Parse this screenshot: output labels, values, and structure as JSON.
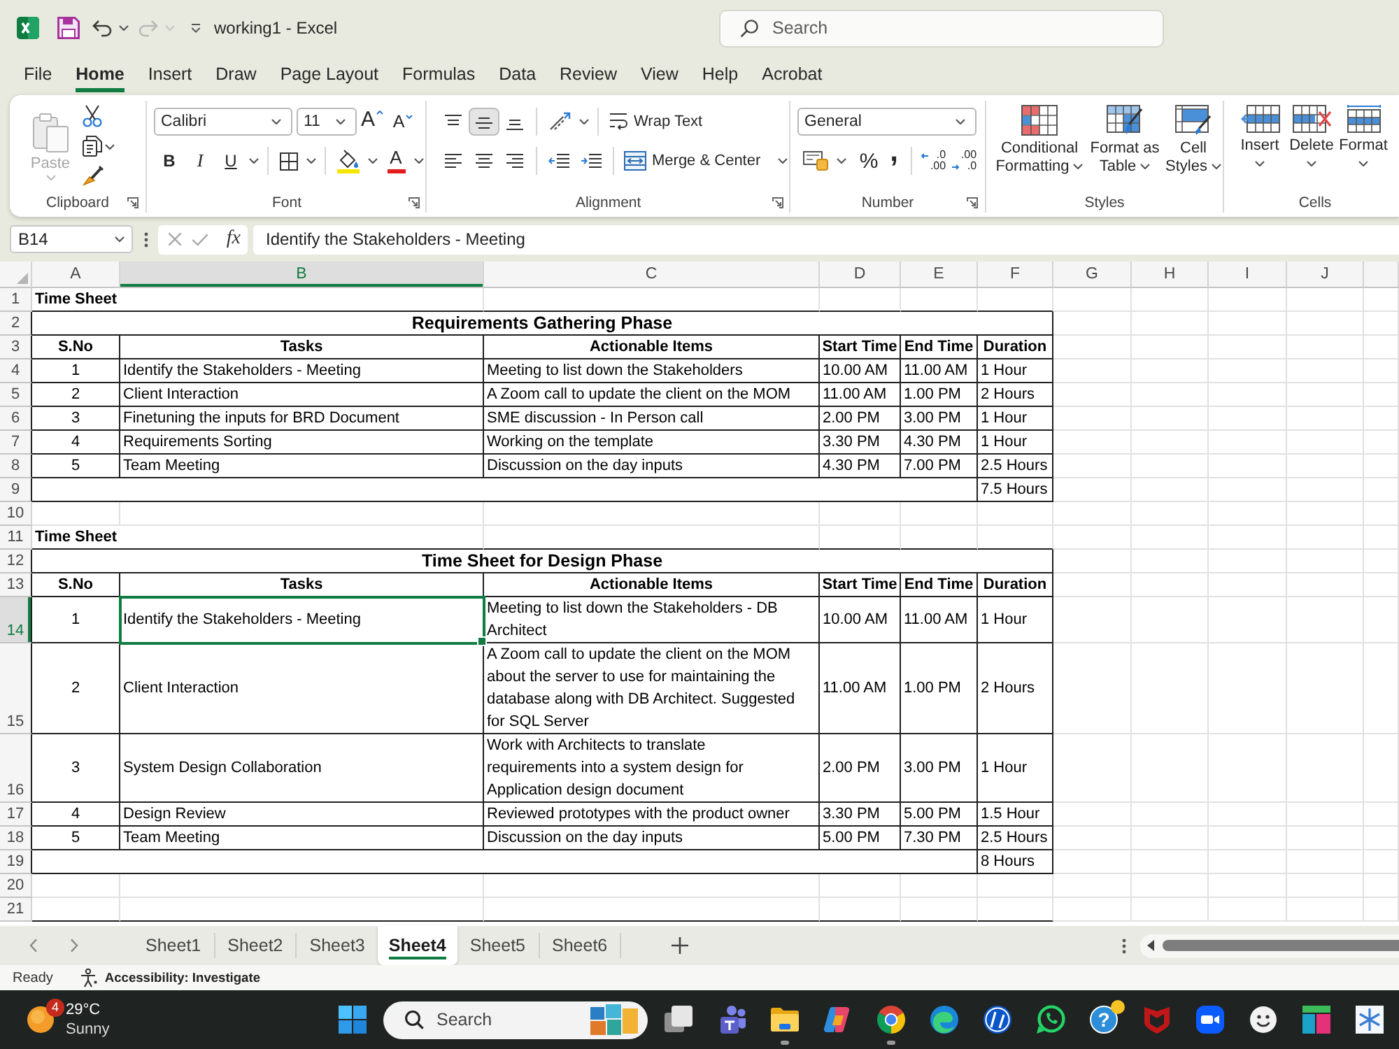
{
  "title_bar": {
    "title": "working1 - Excel",
    "redo": {
      "disabled": true
    },
    "search": {
      "placeholder": "Search"
    }
  },
  "menu_tabs": [
    {
      "label": "File",
      "selected": false
    },
    {
      "label": "Home",
      "selected": true
    },
    {
      "label": "Insert",
      "selected": false
    },
    {
      "label": "Draw",
      "selected": false
    },
    {
      "label": "Page Layout",
      "selected": false
    },
    {
      "label": "Formulas",
      "selected": false
    },
    {
      "label": "Data",
      "selected": false
    },
    {
      "label": "Review",
      "selected": false
    },
    {
      "label": "View",
      "selected": false
    },
    {
      "label": "Help",
      "selected": false
    },
    {
      "label": "Acrobat",
      "selected": false
    }
  ],
  "ribbon": {
    "clipboard": {
      "label": "Clipboard",
      "paste": {
        "label": "Paste",
        "disabled": true
      }
    },
    "font": {
      "label": "Font",
      "font_name": "Calibri",
      "font_size": "11",
      "grow_font": "A",
      "shrink_font": "A",
      "bold": "B",
      "italic": "I",
      "underline": "U",
      "font_color": "A"
    },
    "alignment": {
      "label": "Alignment",
      "vertical": [
        {
          "kind": "top",
          "selected": false
        },
        {
          "kind": "middle",
          "selected": true
        },
        {
          "kind": "bottom",
          "selected": false
        }
      ],
      "wrap_text": "Wrap Text",
      "merge": "Merge & Center"
    },
    "number": {
      "label": "Number",
      "format": "General",
      "percent": "%",
      "comma": ",",
      "increase_decimal": [
        ".0",
        ".00"
      ],
      "decrease_decimal": [
        ".00",
        ".0"
      ]
    },
    "styles": {
      "label": "Styles",
      "buttons": [
        {
          "kind": "conditional",
          "label": "Conditional Formatting"
        },
        {
          "kind": "table",
          "label": "Format as Table"
        },
        {
          "kind": "cell",
          "label": "Cell Styles"
        }
      ]
    },
    "cells": {
      "label": "Cells",
      "buttons": [
        {
          "kind": "insert",
          "label": "Insert"
        },
        {
          "kind": "delete",
          "label": "Delete"
        },
        {
          "kind": "format",
          "label": "Format"
        }
      ]
    }
  },
  "formula_bar": {
    "name_box": "B14",
    "function_label": "fx",
    "formula": "Identify the Stakeholders - Meeting"
  },
  "sheet": {
    "columns": [
      {
        "label": "A",
        "selected": false
      },
      {
        "label": "B",
        "selected": true
      },
      {
        "label": "C",
        "selected": false
      },
      {
        "label": "D",
        "selected": false
      },
      {
        "label": "E",
        "selected": false
      },
      {
        "label": "F",
        "selected": false
      },
      {
        "label": "G",
        "selected": false
      },
      {
        "label": "H",
        "selected": false
      },
      {
        "label": "I",
        "selected": false
      },
      {
        "label": "J",
        "selected": false
      }
    ],
    "rows": [
      {
        "number": "1",
        "selected": false,
        "kind": "title",
        "text": "Time Sheet"
      },
      {
        "number": "2",
        "selected": false,
        "kind": "banner",
        "text": "Requirements Gathering Phase"
      },
      {
        "number": "3",
        "selected": false,
        "kind": "header",
        "cells": [
          "S.No",
          "Tasks",
          "Actionable Items",
          "Start Time",
          "End Time",
          "Duration"
        ]
      },
      {
        "number": "4",
        "selected": false,
        "kind": "record",
        "cells": [
          "1",
          "Identify the Stakeholders - Meeting",
          "Meeting to list down the Stakeholders",
          "10.00 AM",
          "11.00 AM",
          "1 Hour"
        ]
      },
      {
        "number": "5",
        "selected": false,
        "kind": "record",
        "cells": [
          "2",
          "Client Interaction",
          "A Zoom call to update the client on the MOM",
          "11.00 AM",
          "1.00 PM",
          "2 Hours"
        ]
      },
      {
        "number": "6",
        "selected": false,
        "kind": "record",
        "cells": [
          "3",
          "Finetuning the inputs for BRD Document",
          "SME discussion - In Person call",
          "2.00 PM",
          "3.00 PM",
          "1 Hour"
        ]
      },
      {
        "number": "7",
        "selected": false,
        "kind": "record",
        "cells": [
          "4",
          "Requirements Sorting",
          "Working on the template",
          "3.30 PM",
          "4.30 PM",
          "1 Hour"
        ]
      },
      {
        "number": "8",
        "selected": false,
        "kind": "record",
        "cells": [
          "5",
          "Team Meeting",
          "Discussion on the day inputs",
          "4.30 PM",
          "7.00 PM",
          "2.5 Hours"
        ]
      },
      {
        "number": "9",
        "selected": false,
        "kind": "total",
        "text": "7.5 Hours"
      },
      {
        "number": "10",
        "selected": false,
        "kind": "blank"
      },
      {
        "number": "11",
        "selected": false,
        "kind": "title",
        "text": "Time Sheet"
      },
      {
        "number": "12",
        "selected": false,
        "kind": "banner",
        "text": "Time Sheet for Design Phase"
      },
      {
        "number": "13",
        "selected": false,
        "kind": "header",
        "cells": [
          "S.No",
          "Tasks",
          "Actionable Items",
          "Start Time",
          "End Time",
          "Duration"
        ]
      },
      {
        "number": "14",
        "selected": true,
        "kind": "record",
        "cells": [
          "1",
          "Identify the Stakeholders - Meeting",
          "Meeting to list down the Stakeholders - DB\nArchitect",
          "10.00 AM",
          "11.00 AM",
          "1 Hour"
        ]
      },
      {
        "number": "15",
        "selected": false,
        "kind": "record",
        "cells": [
          "2",
          "Client Interaction",
          "A Zoom call to update the client on the MOM\nabout the server to use for maintaining the\ndatabase along with DB Architect. Suggested\nfor SQL Server",
          "11.00 AM",
          "1.00 PM",
          "2 Hours"
        ]
      },
      {
        "number": "16",
        "selected": false,
        "kind": "record",
        "cells": [
          "3",
          "System Design Collaboration",
          "Work with Architects to translate\nrequirements into a system design for\nApplication design document",
          "2.00 PM",
          "3.00 PM",
          "1 Hour"
        ]
      },
      {
        "number": "17",
        "selected": false,
        "kind": "record",
        "cells": [
          "4",
          "Design Review",
          "Reviewed prototypes with the product owner",
          "3.30 PM",
          "5.00 PM",
          "1.5 Hour"
        ]
      },
      {
        "number": "18",
        "selected": false,
        "kind": "record",
        "cells": [
          "5",
          "Team Meeting",
          "Discussion on the day inputs",
          "5.00 PM",
          "7.30 PM",
          "2.5 Hours"
        ]
      },
      {
        "number": "19",
        "selected": false,
        "kind": "total",
        "text": "8 Hours"
      },
      {
        "number": "20",
        "selected": false,
        "kind": "blank"
      },
      {
        "number": "21",
        "selected": false,
        "kind": "blank"
      }
    ]
  },
  "sheet_tabs": [
    {
      "label": "Sheet1",
      "selected": false
    },
    {
      "label": "Sheet2",
      "selected": false
    },
    {
      "label": "Sheet3",
      "selected": false
    },
    {
      "label": "Sheet4",
      "selected": true
    },
    {
      "label": "Sheet5",
      "selected": false
    },
    {
      "label": "Sheet6",
      "selected": false
    }
  ],
  "status_bar": {
    "mode": "Ready",
    "accessibility": "Accessibility: Investigate"
  },
  "taskbar": {
    "weather": {
      "badge": "4",
      "temperature": "29°C",
      "condition": "Sunny"
    },
    "search": {
      "placeholder": "Search"
    },
    "apps": [
      {
        "kind": "task-view",
        "running": false,
        "alert": false
      },
      {
        "kind": "teams",
        "running": false,
        "alert": false
      },
      {
        "kind": "explorer",
        "running": true,
        "alert": false
      },
      {
        "kind": "copilot",
        "running": false,
        "alert": false
      },
      {
        "kind": "chrome",
        "running": true,
        "alert": false
      },
      {
        "kind": "edge",
        "running": false,
        "alert": false
      },
      {
        "kind": "hp",
        "running": false,
        "alert": false
      },
      {
        "kind": "whatsapp",
        "running": false,
        "alert": false
      },
      {
        "kind": "help",
        "glyph": "?",
        "running": false,
        "alert": true
      },
      {
        "kind": "shield",
        "running": false,
        "alert": false
      },
      {
        "kind": "zoom",
        "running": false,
        "alert": false
      },
      {
        "kind": "smiley",
        "running": false,
        "alert": false
      },
      {
        "kind": "blocks",
        "running": false,
        "alert": false
      },
      {
        "kind": "snowflake",
        "running": false,
        "alert": false
      }
    ]
  }
}
